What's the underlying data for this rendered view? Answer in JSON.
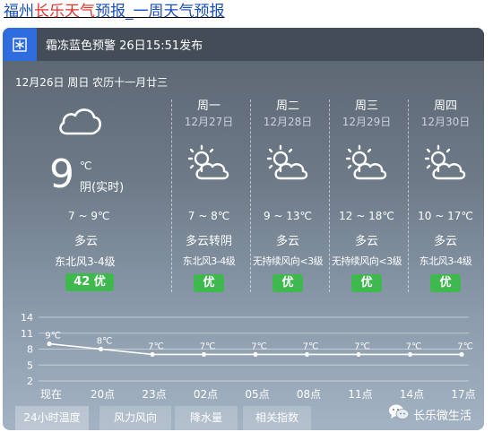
{
  "title": {
    "part1": "福州",
    "part2": "长乐天气",
    "part3": "预报_一周天气预报"
  },
  "alert": {
    "icon": "frost-warning-icon",
    "text": "霜冻蓝色预警 26日15:51发布"
  },
  "today": {
    "date_line": "12月26日 周日 农历十一月廿三",
    "icon": "cloudy-icon",
    "temp": "9",
    "unit": "℃",
    "desc": "阴(实时)",
    "range": "7 ~ 9℃",
    "condition": "多云",
    "wind": "东北风3-4级",
    "aqi": "42 优"
  },
  "forecast": [
    {
      "day": "周一",
      "date": "12月27日",
      "icon": "partly-cloudy-icon",
      "range": "7 ~ 8℃",
      "condition": "多云转阴",
      "wind": "东北风3-4级",
      "aqi": "优"
    },
    {
      "day": "周二",
      "date": "12月28日",
      "icon": "partly-cloudy-icon",
      "range": "9 ~ 13℃",
      "condition": "多云",
      "wind": "无持续风向<3级",
      "aqi": "优"
    },
    {
      "day": "周三",
      "date": "12月29日",
      "icon": "partly-cloudy-icon",
      "range": "12 ~ 18℃",
      "condition": "多云",
      "wind": "无持续风向<3级",
      "aqi": "优"
    },
    {
      "day": "周四",
      "date": "12月30日",
      "icon": "partly-cloudy-icon",
      "range": "10 ~ 17℃",
      "condition": "多云",
      "wind": "东北风3-4级",
      "aqi": "优"
    }
  ],
  "chart_data": {
    "type": "line",
    "x": [
      "现在",
      "20点",
      "23点",
      "02点",
      "05点",
      "08点",
      "11点",
      "14点",
      "17点"
    ],
    "series": [
      {
        "values": [
          9,
          8,
          7,
          7,
          7,
          7,
          7,
          7,
          7
        ]
      }
    ],
    "point_labels": [
      "9℃",
      "8℃",
      "7℃",
      "7℃",
      "7℃",
      "7℃",
      "7℃",
      "7℃",
      "7℃"
    ],
    "yticks": [
      14,
      11,
      8,
      5,
      2
    ],
    "ylim": [
      2,
      14
    ],
    "grid": true,
    "line_color": "#ffffff"
  },
  "tabs": [
    "24小时温度",
    "风力风向",
    "降水量",
    "相关指数"
  ],
  "wechat": {
    "icon": "wechat-icon",
    "label": "长乐微生活"
  },
  "colors": {
    "accent_blue": "#2f6dde",
    "aqi_green": "#3fb84e",
    "title_red": "#e0322b",
    "title_blue": "#1a4fb8"
  }
}
